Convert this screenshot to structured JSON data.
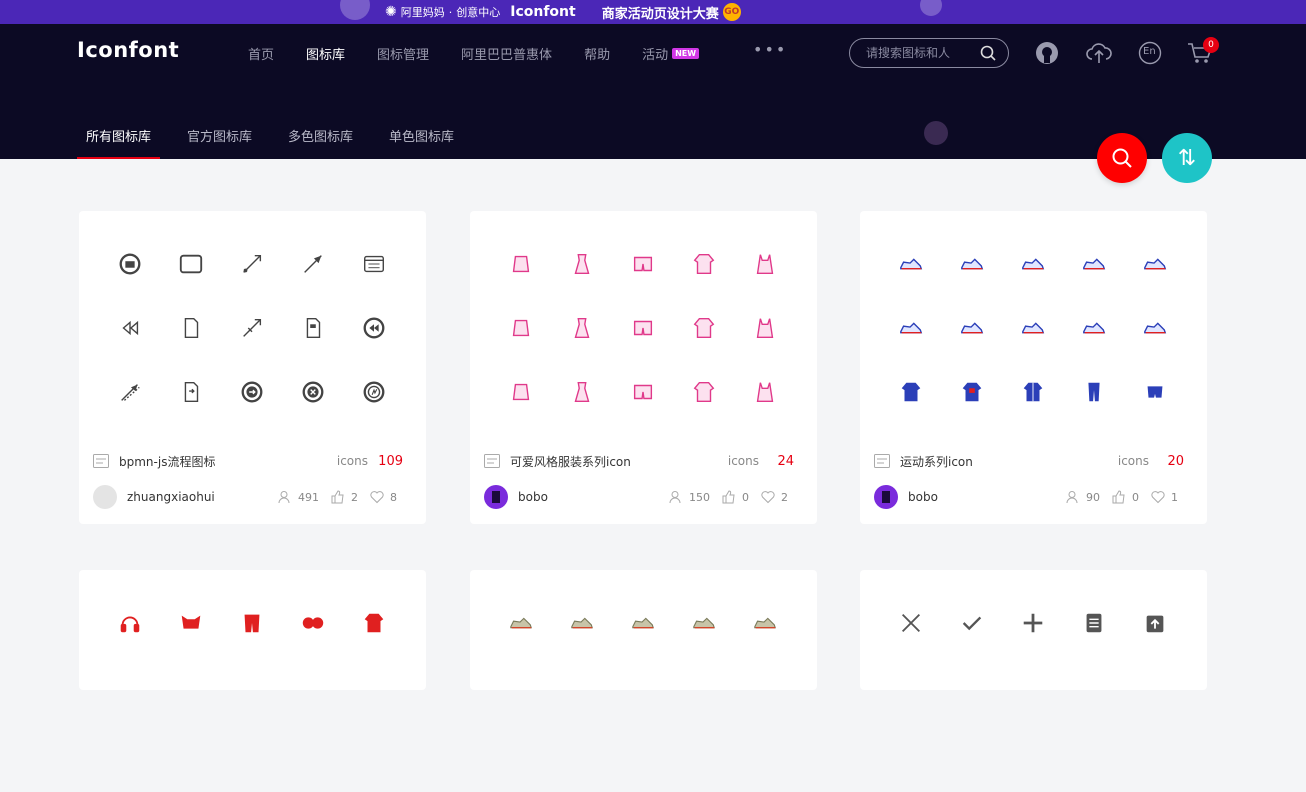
{
  "banner": {
    "alimama": "阿里妈妈",
    "sep": "·",
    "center": "创意中心",
    "brand": "Iconfont",
    "promo": "商家活动页设计大赛",
    "go": "GO"
  },
  "header": {
    "logo": "Iconfont",
    "nav": [
      {
        "label": "首页"
      },
      {
        "label": "图标库",
        "active": true
      },
      {
        "label": "图标管理"
      },
      {
        "label": "阿里巴巴普惠体"
      },
      {
        "label": "帮助"
      },
      {
        "label": "活动",
        "badge": "NEW"
      }
    ],
    "more": "•••",
    "search_placeholder": "请搜索图标和人",
    "lang": "En",
    "cart_count": "0"
  },
  "tabs": [
    {
      "label": "所有图标库",
      "active": true
    },
    {
      "label": "官方图标库"
    },
    {
      "label": "多色图标库"
    },
    {
      "label": "单色图标库"
    }
  ],
  "colors": {
    "accent": "#e60012",
    "header_bg": "#0c0a24",
    "banner_bg": "#4b27b7",
    "sort_fab": "#1ec4c7"
  },
  "cards": [
    {
      "title": "bpmn-js流程图标",
      "count_label": "icons",
      "count": "109",
      "author": "zhuangxiaohui",
      "followers": "491",
      "likes": "2",
      "favorites": "8",
      "icon_color": "#444",
      "icon_set": "bpmn"
    },
    {
      "title": "可爱风格服装系列icon",
      "count_label": "icons",
      "count": "24",
      "author": "bobo",
      "followers": "150",
      "likes": "0",
      "favorites": "2",
      "icon_color": "#e0398a",
      "icon_set": "clothes-pink"
    },
    {
      "title": "运动系列icon",
      "count_label": "icons",
      "count": "20",
      "author": "bobo",
      "followers": "90",
      "likes": "0",
      "favorites": "1",
      "icon_color": "#2b3fb8",
      "icon_set": "sport-blue"
    },
    {
      "icon_color": "#e02020",
      "icon_set": "sport-red"
    },
    {
      "icon_color": "#7a7a5a",
      "icon_set": "shoes"
    },
    {
      "icon_color": "#555",
      "icon_set": "ui-gray"
    }
  ]
}
